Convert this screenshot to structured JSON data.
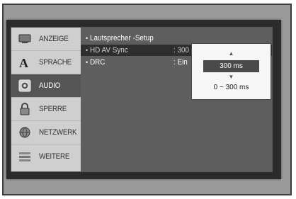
{
  "sidebar": {
    "items": [
      {
        "label": "ANZEIGE",
        "icon": "display-icon"
      },
      {
        "label": "SPRACHE",
        "icon": "language-icon"
      },
      {
        "label": "AUDIO",
        "icon": "audio-icon"
      },
      {
        "label": "SPERRE",
        "icon": "lock-icon"
      },
      {
        "label": "NETZWERK",
        "icon": "globe-icon"
      },
      {
        "label": "WEITERE",
        "icon": "other-icon"
      }
    ],
    "active_index": 2
  },
  "settings": {
    "rows": [
      {
        "bullet": "•",
        "name": "Lautsprecher -Setup",
        "value": ""
      },
      {
        "bullet": "•",
        "name": "HD AV Sync",
        "value": ": 300 ms"
      },
      {
        "bullet": "•",
        "name": "DRC",
        "value": ": Ein"
      }
    ],
    "selected_index": 1
  },
  "popup": {
    "up_arrow": "▲",
    "current_value": "300 ms",
    "down_arrow": "▼",
    "range": "0 ~ 300 ms"
  }
}
